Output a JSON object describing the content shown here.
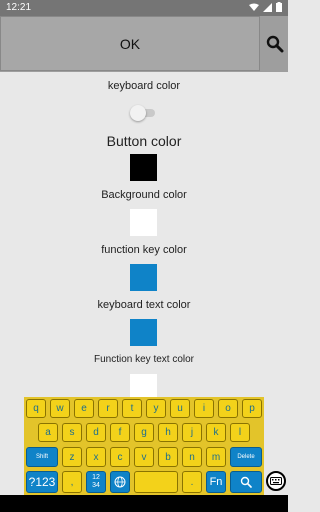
{
  "status_bar": {
    "time": "12:21",
    "icons": [
      "wifi-icon",
      "signal-icon",
      "battery-icon"
    ]
  },
  "top_bar": {
    "ok_label": "OK",
    "search_icon": "search-icon"
  },
  "settings": {
    "keyboard_color_label": "keyboard color",
    "button_color_label": "Button color",
    "background_color_label": "Background color",
    "function_key_color_label": "function key color",
    "keyboard_text_color_label": "keyboard text color",
    "function_key_text_color_label": "Function key text color"
  },
  "colors": {
    "status_bar": "#757575",
    "top_bar": "#9e9e9e",
    "button_color": "#000000",
    "background_color": "#ffffff",
    "function_key_color": "#0f83c8",
    "keyboard_text_color": "#0f83c8",
    "function_key_text_color": "#ffffff",
    "keyboard_background": "#e3c42a",
    "key_face": "#f3d21a"
  },
  "keyboard": {
    "row1": [
      "q",
      "w",
      "e",
      "r",
      "t",
      "y",
      "u",
      "i",
      "o",
      "p"
    ],
    "row2": [
      "a",
      "s",
      "d",
      "f",
      "g",
      "h",
      "j",
      "k",
      "l"
    ],
    "row3": [
      "z",
      "x",
      "c",
      "v",
      "b",
      "n",
      "m"
    ],
    "shift": "Shift",
    "delete": "Delete",
    "num_label": "?123",
    "comma": ",",
    "pager_top": "12",
    "pager_bottom": "34",
    "period": ".",
    "fn_label": "Fn"
  }
}
